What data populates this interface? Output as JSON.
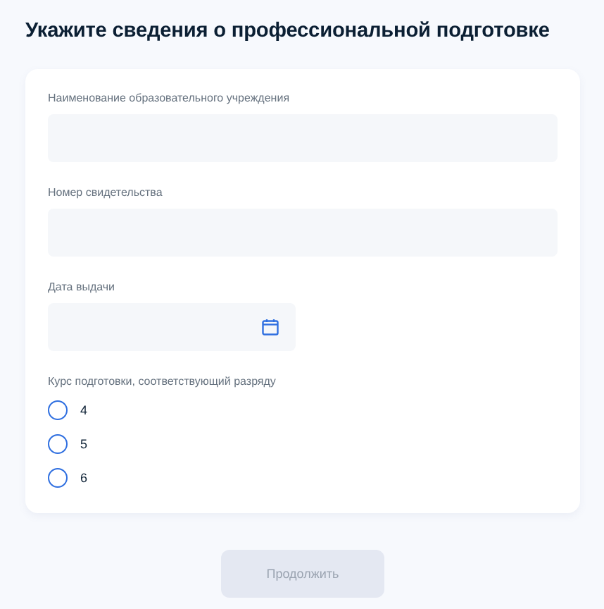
{
  "title": "Укажите сведения о профессиональной подготовке",
  "fields": [
    {
      "label": "Наименование образовательного учреждения",
      "kind": "text"
    },
    {
      "label": "Номер свидетельства",
      "kind": "text"
    },
    {
      "label": "Дата выдачи",
      "kind": "date"
    }
  ],
  "radio_group": {
    "label": "Курс подготовки, соответствующий разряду",
    "options": [
      {
        "label": "4",
        "selected": false
      },
      {
        "label": "5",
        "selected": false
      },
      {
        "label": "6",
        "selected": false
      }
    ]
  },
  "button": {
    "label": "Продолжить",
    "disabled": true
  }
}
